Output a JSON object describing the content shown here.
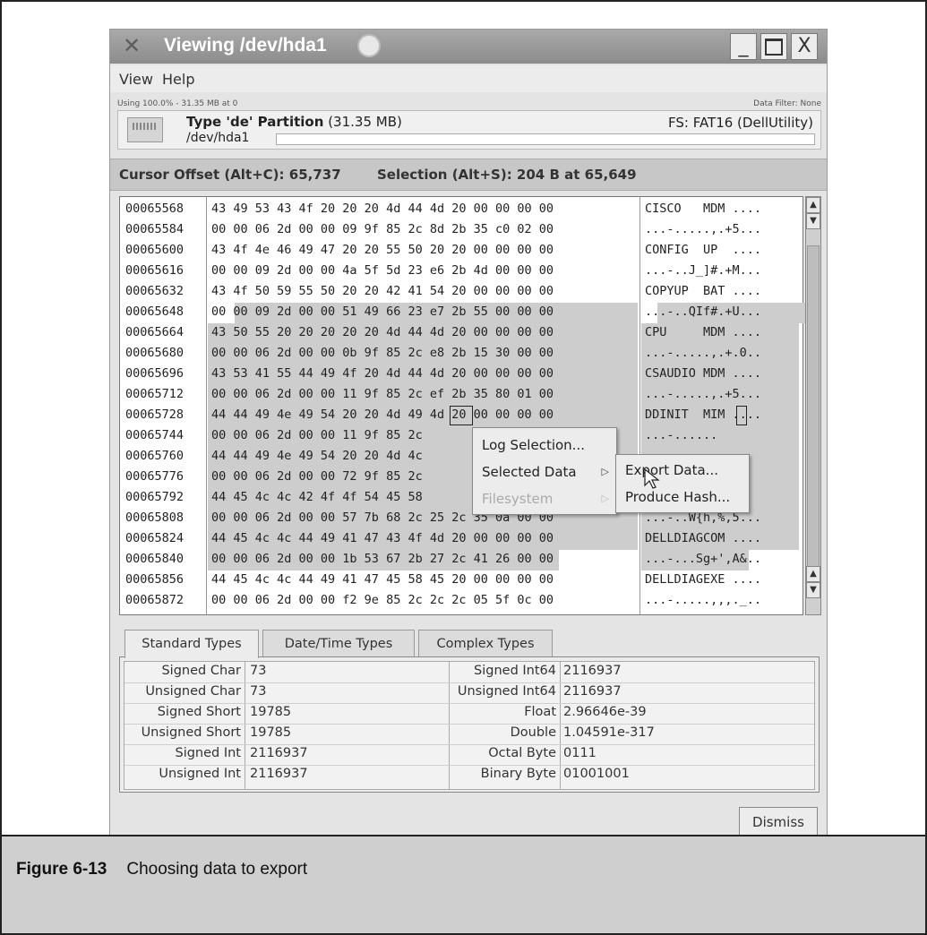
{
  "window": {
    "title": "Viewing /dev/hda1",
    "min_label": "_",
    "close_label": "X"
  },
  "menu": [
    "View",
    "Help"
  ],
  "info": {
    "usage": "Using 100.0% - 31.35 MB at 0",
    "filter": "Data Filter: None",
    "partition_type_prefix": "Type 'de' Partition",
    "partition_size": "(31.35 MB)",
    "path": "/dev/hda1",
    "fs": "FS: FAT16 (DellUtility)"
  },
  "status": {
    "cursor": "Cursor Offset (Alt+C): 65,737",
    "selection": "Selection (Alt+S): 204 B at 65,649"
  },
  "hex_rows": [
    {
      "offset": "00065568",
      "hex": "43 49 53 43 4f 20 20 20 4d 44 4d 20 00 00 00 00",
      "ascii": "CISCO   MDM ...."
    },
    {
      "offset": "00065584",
      "hex": "00 00 06 2d 00 00 09 9f 85 2c 8d 2b 35 c0 02 00",
      "ascii": "...-.....,.+5..."
    },
    {
      "offset": "00065600",
      "hex": "43 4f 4e 46 49 47 20 20 55 50 20 20 00 00 00 00",
      "ascii": "CONFIG  UP  ...."
    },
    {
      "offset": "00065616",
      "hex": "00 00 09 2d 00 00 4a 5f 5d 23 e6 2b 4d 00 00 00",
      "ascii": "...-..J_]#.+M..."
    },
    {
      "offset": "00065632",
      "hex": "43 4f 50 59 55 50 20 20 42 41 54 20 00 00 00 00",
      "ascii": "COPYUP  BAT ...."
    },
    {
      "offset": "00065648",
      "hex": "00 00 09 2d 00 00 51 49 66 23 e7 2b 55 00 00 00",
      "ascii": "...-..QIf#.+U..."
    },
    {
      "offset": "00065664",
      "hex": "43 50 55 20 20 20 20 20 4d 44 4d 20 00 00 00 00",
      "ascii": "CPU     MDM ...."
    },
    {
      "offset": "00065680",
      "hex": "00 00 06 2d 00 00 0b 9f 85 2c e8 2b 15 30 00 00",
      "ascii": "...-.....,.+.0.."
    },
    {
      "offset": "00065696",
      "hex": "43 53 41 55 44 49 4f 20 4d 44 4d 20 00 00 00 00",
      "ascii": "CSAUDIO MDM ...."
    },
    {
      "offset": "00065712",
      "hex": "00 00 06 2d 00 00 11 9f 85 2c ef 2b 35 80 01 00",
      "ascii": "...-.....,.+5..."
    },
    {
      "offset": "00065728",
      "hex": "44 44 49 4e 49 54 20 20 4d 49 4d 20 00 00 00 00",
      "ascii": "DDINIT  MIM ...."
    },
    {
      "offset": "00065744",
      "hex": "00 00 06 2d 00 00 11 9f 85 2c",
      "ascii": "...-......"
    },
    {
      "offset": "00065760",
      "hex": "44 44 49 4e 49 54 20 20 4d 4c",
      "ascii": ""
    },
    {
      "offset": "00065776",
      "hex": "00 00 06 2d 00 00 72 9f 85 2c",
      "ascii": ""
    },
    {
      "offset": "00065792",
      "hex": "44 45 4c 4c 42 4f 4f 54 45 58",
      "ascii": ""
    },
    {
      "offset": "00065808",
      "hex": "00 00 06 2d 00 00 57 7b 68 2c 25 2c 35 0a 00 00",
      "ascii": "...-..W{h,%,5..."
    },
    {
      "offset": "00065824",
      "hex": "44 45 4c 4c 44 49 41 47 43 4f 4d 20 00 00 00 00",
      "ascii": "DELLDIAGCOM ...."
    },
    {
      "offset": "00065840",
      "hex": "00 00 06 2d 00 00 1b 53 67 2b 27 2c 41 26 00 00",
      "ascii": "...-...Sg+',A&.."
    },
    {
      "offset": "00065856",
      "hex": "44 45 4c 4c 44 49 41 47 45 58 45 20 00 00 00 00",
      "ascii": "DELLDIAGEXE ...."
    },
    {
      "offset": "00065872",
      "hex": "00 00 06 2d 00 00 f2 9e 85 2c 2c 2c 05 5f 0c 00",
      "ascii": "...-.....,,,._.."
    }
  ],
  "context_menu": {
    "items": [
      "Log Selection...",
      "Selected Data",
      "Filesystem"
    ],
    "submenu": [
      "Export Data...",
      "Produce Hash..."
    ]
  },
  "tabs": [
    "Standard Types",
    "Date/Time Types",
    "Complex Types"
  ],
  "types_left": [
    {
      "label": "Signed Char",
      "value": "73"
    },
    {
      "label": "Unsigned Char",
      "value": "73"
    },
    {
      "label": "Signed Short",
      "value": "19785"
    },
    {
      "label": "Unsigned Short",
      "value": "19785"
    },
    {
      "label": "Signed Int",
      "value": "2116937"
    },
    {
      "label": "Unsigned Int",
      "value": "2116937"
    }
  ],
  "types_right": [
    {
      "label": "Signed Int64",
      "value": "2116937"
    },
    {
      "label": "Unsigned Int64",
      "value": "2116937"
    },
    {
      "label": "Float",
      "value": "2.96646e-39"
    },
    {
      "label": "Double",
      "value": "1.04591e-317"
    },
    {
      "label": "Octal Byte",
      "value": "0111"
    },
    {
      "label": "Binary Byte",
      "value": "01001001"
    }
  ],
  "dismiss_label": "Dismiss",
  "caption": {
    "figure": "Figure 6-13",
    "text": "Choosing data to export"
  }
}
